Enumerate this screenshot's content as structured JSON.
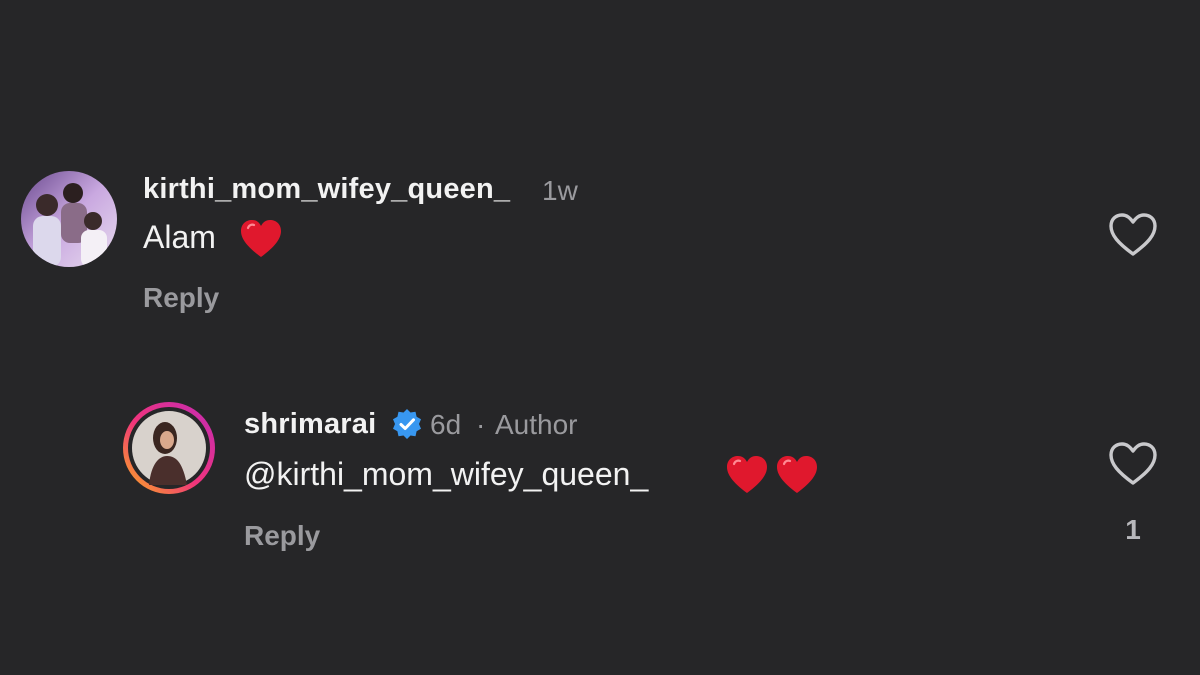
{
  "comments": [
    {
      "username": "kirthi_mom_wifey_queen_",
      "time": "1w",
      "text": "Alam",
      "reply_label": "Reply",
      "avatar_icon": "family-photo-avatar",
      "emoji": [
        "red-heart"
      ]
    },
    {
      "username": "shrimarai",
      "verified": true,
      "time": "6d",
      "separator": "·",
      "role": "Author",
      "text": "@kirthi_mom_wifey_queen_",
      "reply_label": "Reply",
      "like_count": "1",
      "avatar_icon": "profile-photo-avatar-with-story-ring",
      "emoji": [
        "red-heart",
        "red-heart"
      ]
    }
  ],
  "colors": {
    "background": "#262628",
    "primary_text": "#f2f2f2",
    "secondary_text": "#9a9a9e",
    "verified_blue": "#3897f0",
    "heart_red": "#e0182d"
  }
}
